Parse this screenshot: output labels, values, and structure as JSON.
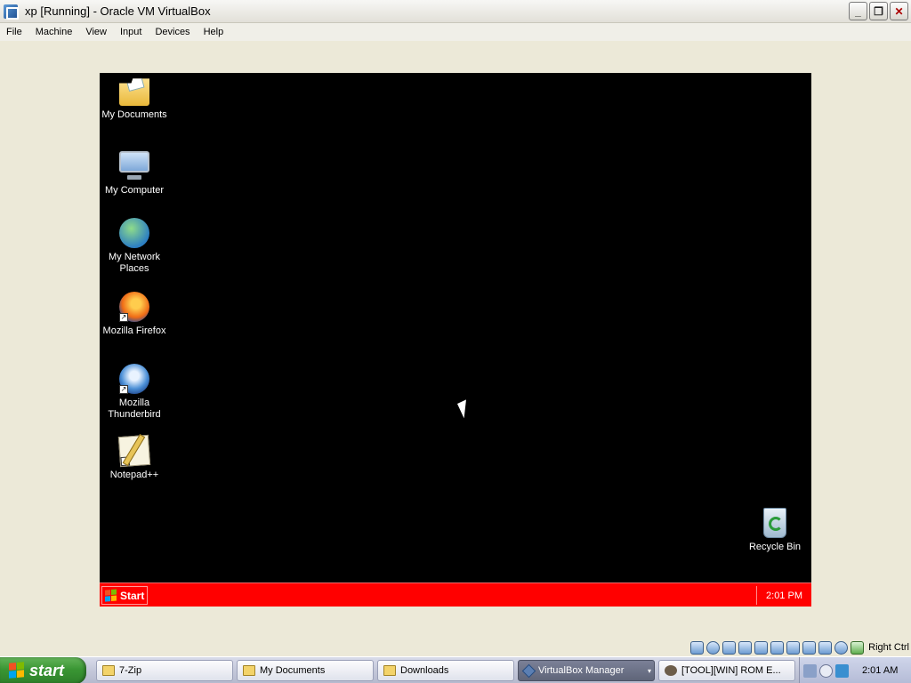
{
  "window": {
    "title": "xp [Running] - Oracle VM VirtualBox",
    "minimize": "_",
    "restore": "❐",
    "close": "✕"
  },
  "menu": [
    "File",
    "Machine",
    "View",
    "Input",
    "Devices",
    "Help"
  ],
  "guest": {
    "desktop_icons": [
      {
        "name": "my-documents",
        "label": "My Documents",
        "icon": "documents-folder-icon"
      },
      {
        "name": "my-computer",
        "label": "My Computer",
        "icon": "computer-icon"
      },
      {
        "name": "my-network-places",
        "label": "My Network Places",
        "icon": "network-globe-icon"
      },
      {
        "name": "mozilla-firefox",
        "label": "Mozilla Firefox",
        "icon": "firefox-icon",
        "shortcut": true
      },
      {
        "name": "mozilla-thunderbird",
        "label": "Mozilla Thunderbird",
        "icon": "thunderbird-icon",
        "shortcut": true
      },
      {
        "name": "notepad-plus-plus",
        "label": "Notepad++",
        "icon": "notepad-icon",
        "shortcut": true
      },
      {
        "name": "recycle-bin",
        "label": "Recycle Bin",
        "icon": "recycle-bin-icon"
      }
    ],
    "taskbar": {
      "start_label": "Start",
      "clock": "2:01 PM",
      "color": "#ff0000"
    },
    "desktop_color": "#000000"
  },
  "vbox_status": {
    "host_key": "Right Ctrl"
  },
  "host_taskbar": {
    "start_label": "start",
    "tasks": [
      {
        "label": "7-Zip",
        "icon": "folder-icon"
      },
      {
        "label": "My Documents",
        "icon": "folder-icon"
      },
      {
        "label": "Downloads",
        "icon": "folder-icon"
      },
      {
        "label": "VirtualBox Manager",
        "icon": "virtualbox-icon",
        "active": true
      },
      {
        "label": "[TOOL][WIN] ROM E...",
        "icon": "tool-icon"
      }
    ],
    "clock": "2:01 AM"
  }
}
